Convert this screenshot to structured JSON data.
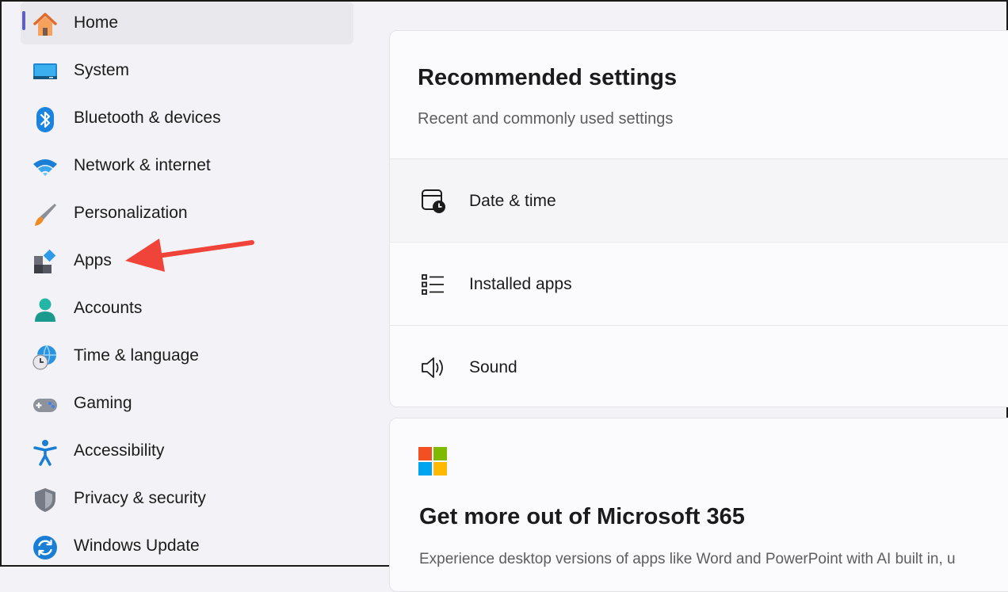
{
  "sidebar": {
    "items": [
      {
        "label": "Home",
        "icon": "home-icon"
      },
      {
        "label": "System",
        "icon": "monitor-icon"
      },
      {
        "label": "Bluetooth & devices",
        "icon": "bluetooth-icon"
      },
      {
        "label": "Network & internet",
        "icon": "wifi-icon"
      },
      {
        "label": "Personalization",
        "icon": "paintbrush-icon"
      },
      {
        "label": "Apps",
        "icon": "apps-icon"
      },
      {
        "label": "Accounts",
        "icon": "user-icon"
      },
      {
        "label": "Time & language",
        "icon": "globe-clock-icon"
      },
      {
        "label": "Gaming",
        "icon": "gamepad-icon"
      },
      {
        "label": "Accessibility",
        "icon": "accessibility-icon"
      },
      {
        "label": "Privacy & security",
        "icon": "shield-icon"
      },
      {
        "label": "Windows Update",
        "icon": "sync-icon"
      }
    ],
    "selected": "Home"
  },
  "recommended": {
    "title": "Recommended settings",
    "subtitle": "Recent and commonly used settings",
    "rows": [
      {
        "label": "Date & time",
        "icon": "calendar-clock-icon"
      },
      {
        "label": "Installed apps",
        "icon": "list-icon"
      },
      {
        "label": "Sound",
        "icon": "speaker-icon"
      }
    ]
  },
  "microsoft365": {
    "title": "Get more out of Microsoft 365",
    "body": "Experience desktop versions of apps like Word and PowerPoint with AI built in, u",
    "logo": "microsoft-logo"
  },
  "annotation": {
    "icon": "red-arrow-icon",
    "color": "#f0443a"
  },
  "colors": {
    "accent": "#5b5fc7",
    "background": "#f3f3f7",
    "card": "#fbfbfd"
  }
}
